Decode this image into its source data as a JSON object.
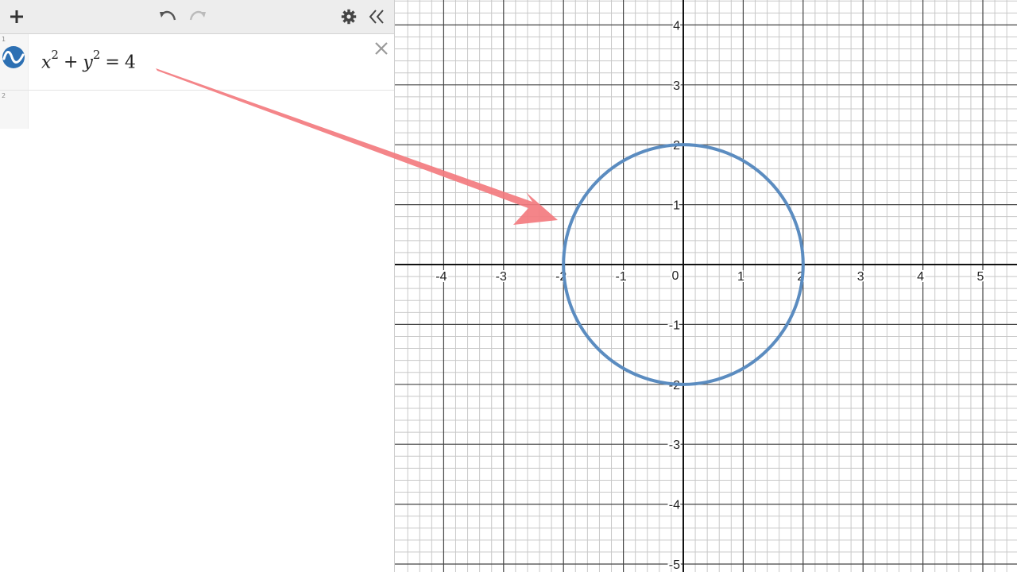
{
  "toolbar": {
    "add_icon": "plus-icon",
    "undo_icon": "undo-icon",
    "redo_icon": "redo-icon",
    "settings_icon": "gear-icon",
    "collapse_icon": "double-chevron-left-icon"
  },
  "expressions": [
    {
      "index": "1",
      "icon": "wave-icon",
      "color": "#2d70b3",
      "latex": "x^2 + y^2 = 4",
      "parts": {
        "var1": "x",
        "exp1": "2",
        "plus": "+",
        "var2": "y",
        "exp2": "2",
        "equals": "=",
        "rhs": "4"
      }
    },
    {
      "index": "2",
      "latex": ""
    }
  ],
  "graph": {
    "x_range": [
      -4.8,
      5.6
    ],
    "y_range": [
      -5.1,
      4.4
    ],
    "x_ticks": [
      "-4",
      "-3",
      "-2",
      "-1",
      "1",
      "2",
      "3",
      "4",
      "5"
    ],
    "y_ticks": [
      "4",
      "3",
      "2",
      "1",
      "-1",
      "-2",
      "-3",
      "-4",
      "-5"
    ],
    "origin_label": "0",
    "minor_grid_step": 0.2,
    "major_grid_step": 1,
    "curve": {
      "type": "circle",
      "center": [
        0,
        0
      ],
      "radius": 2,
      "color": "#5b8cc0"
    },
    "annotation_arrow": {
      "color": "#f37b7f",
      "from": "expression-row",
      "to": [
        -2,
        0.75
      ]
    }
  },
  "colors": {
    "axis": "#111111",
    "major_grid": "#444444",
    "minor_grid": "#c8c8c8",
    "toolbar_bg": "#ededed"
  }
}
